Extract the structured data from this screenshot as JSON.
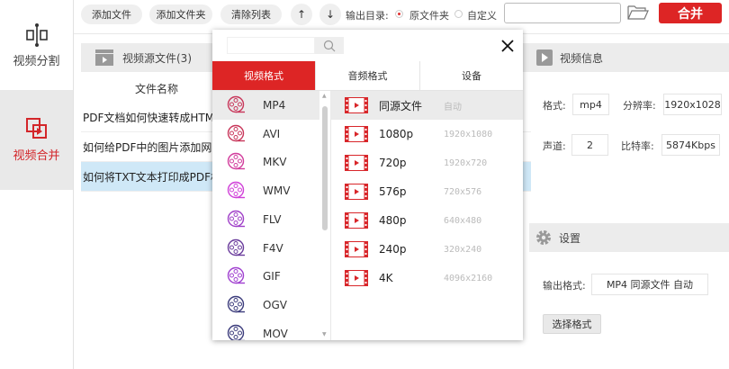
{
  "sidebar": {
    "items": [
      {
        "label": "视频分割"
      },
      {
        "label": "视频合并"
      }
    ]
  },
  "toolbar": {
    "add_file": "添加文件",
    "add_folder": "添加文件夹",
    "clear_list": "清除列表",
    "up": "↑",
    "down": "↓",
    "output_dir_label": "输出目录:",
    "opt_source": "原文件夹",
    "opt_custom": "自定义",
    "output_path": "",
    "merge": "合并"
  },
  "source": {
    "title": "视频源文件(3)",
    "col_name": "文件名称",
    "files": [
      "PDF文档如何快速转成HTML",
      "如何给PDF中的图片添加网页",
      "如何将TXT文本打印成PDF格"
    ]
  },
  "popup": {
    "search_value": "",
    "tabs": [
      "视频格式",
      "音频格式",
      "设备"
    ],
    "formats": [
      {
        "name": "MP4",
        "color": "#c8365a"
      },
      {
        "name": "AVI",
        "color": "#c8365a"
      },
      {
        "name": "MKV",
        "color": "#d23c9c"
      },
      {
        "name": "WMV",
        "color": "#d040d8"
      },
      {
        "name": "FLV",
        "color": "#a040c8"
      },
      {
        "name": "F4V",
        "color": "#6a3c9c"
      },
      {
        "name": "GIF",
        "color": "#a040d0"
      },
      {
        "name": "OGV",
        "color": "#3c3c7c"
      },
      {
        "name": "MOV",
        "color": "#3c3c7c"
      }
    ],
    "resolutions": [
      {
        "name": "同源文件",
        "dim": "自动"
      },
      {
        "name": "1080p",
        "dim": "1920x1080"
      },
      {
        "name": "720p",
        "dim": "1920x720"
      },
      {
        "name": "576p",
        "dim": "720x576"
      },
      {
        "name": "480p",
        "dim": "640x480"
      },
      {
        "name": "240p",
        "dim": "320x240"
      },
      {
        "name": "4K",
        "dim": "4096x2160"
      }
    ]
  },
  "info": {
    "title": "视频信息",
    "format_label": "格式:",
    "format": "mp4",
    "res_label": "分辨率:",
    "res": "1920x1028",
    "channel_label": "声道:",
    "channel": "2",
    "bitrate_label": "比特率:",
    "bitrate": "5874Kbps"
  },
  "settings": {
    "title": "设置",
    "output_label": "输出格式:",
    "output_value": "MP4 同源文件 自动",
    "choose": "选择格式"
  },
  "colors": {
    "accent": "#dd2525"
  }
}
